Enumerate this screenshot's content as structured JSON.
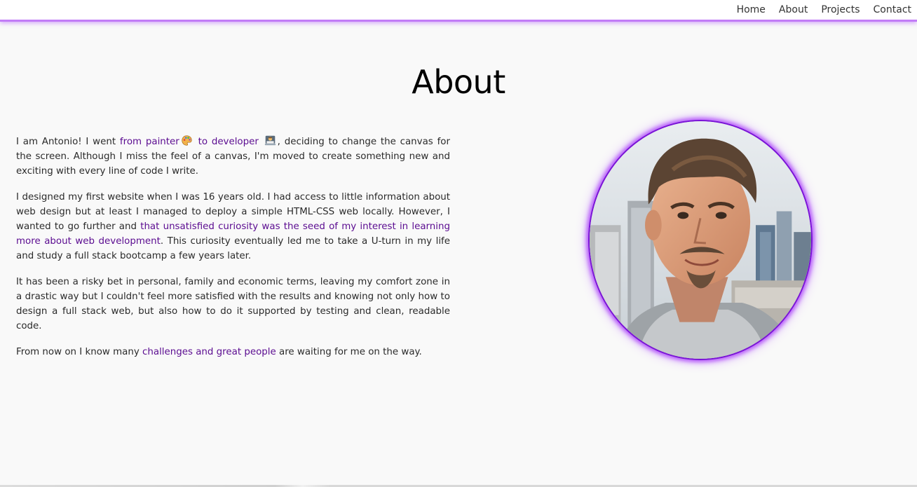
{
  "nav": {
    "links": [
      "Home",
      "About",
      "Projects",
      "Contact"
    ]
  },
  "page": {
    "title": "About"
  },
  "bio": {
    "p1": {
      "before": "I am Antonio! I went ",
      "hl1": "from painter",
      "emoji1": "palette-icon",
      "hl2": "to developer",
      "emoji2": "technologist-icon",
      "after": ", deciding to change the canvas for the screen. Although I miss the feel of a canvas, I'm moved to create something new and exciting with every line of code I write."
    },
    "p2": {
      "before": "I designed my first website when I was 16 years old. I had access to little information about web design but at least I managed to deploy a simple HTML-CSS web locally. However, I wanted to go further and ",
      "hl": "that unsatisfied curiosity was the seed of my interest in learning more about web development",
      "after": ". This curiosity eventually led me to take a U-turn in my life and study a full stack bootcamp a few years later."
    },
    "p3": {
      "text": "It has been a risky bet in personal, family and economic terms, leaving my comfort zone in a drastic way but I couldn't feel more satisfied with the results and knowing not only how to design a full stack web, but also how to do it supported by testing and clean, readable code."
    },
    "p4": {
      "before": "From now on I know many ",
      "hl": "challenges and great people",
      "after": " are waiting for me on the way."
    }
  },
  "colors": {
    "accent": "#c27cf7",
    "highlight_text": "#5a0b90",
    "portrait_border": "#7a14d6",
    "background": "#f9f9f9"
  }
}
